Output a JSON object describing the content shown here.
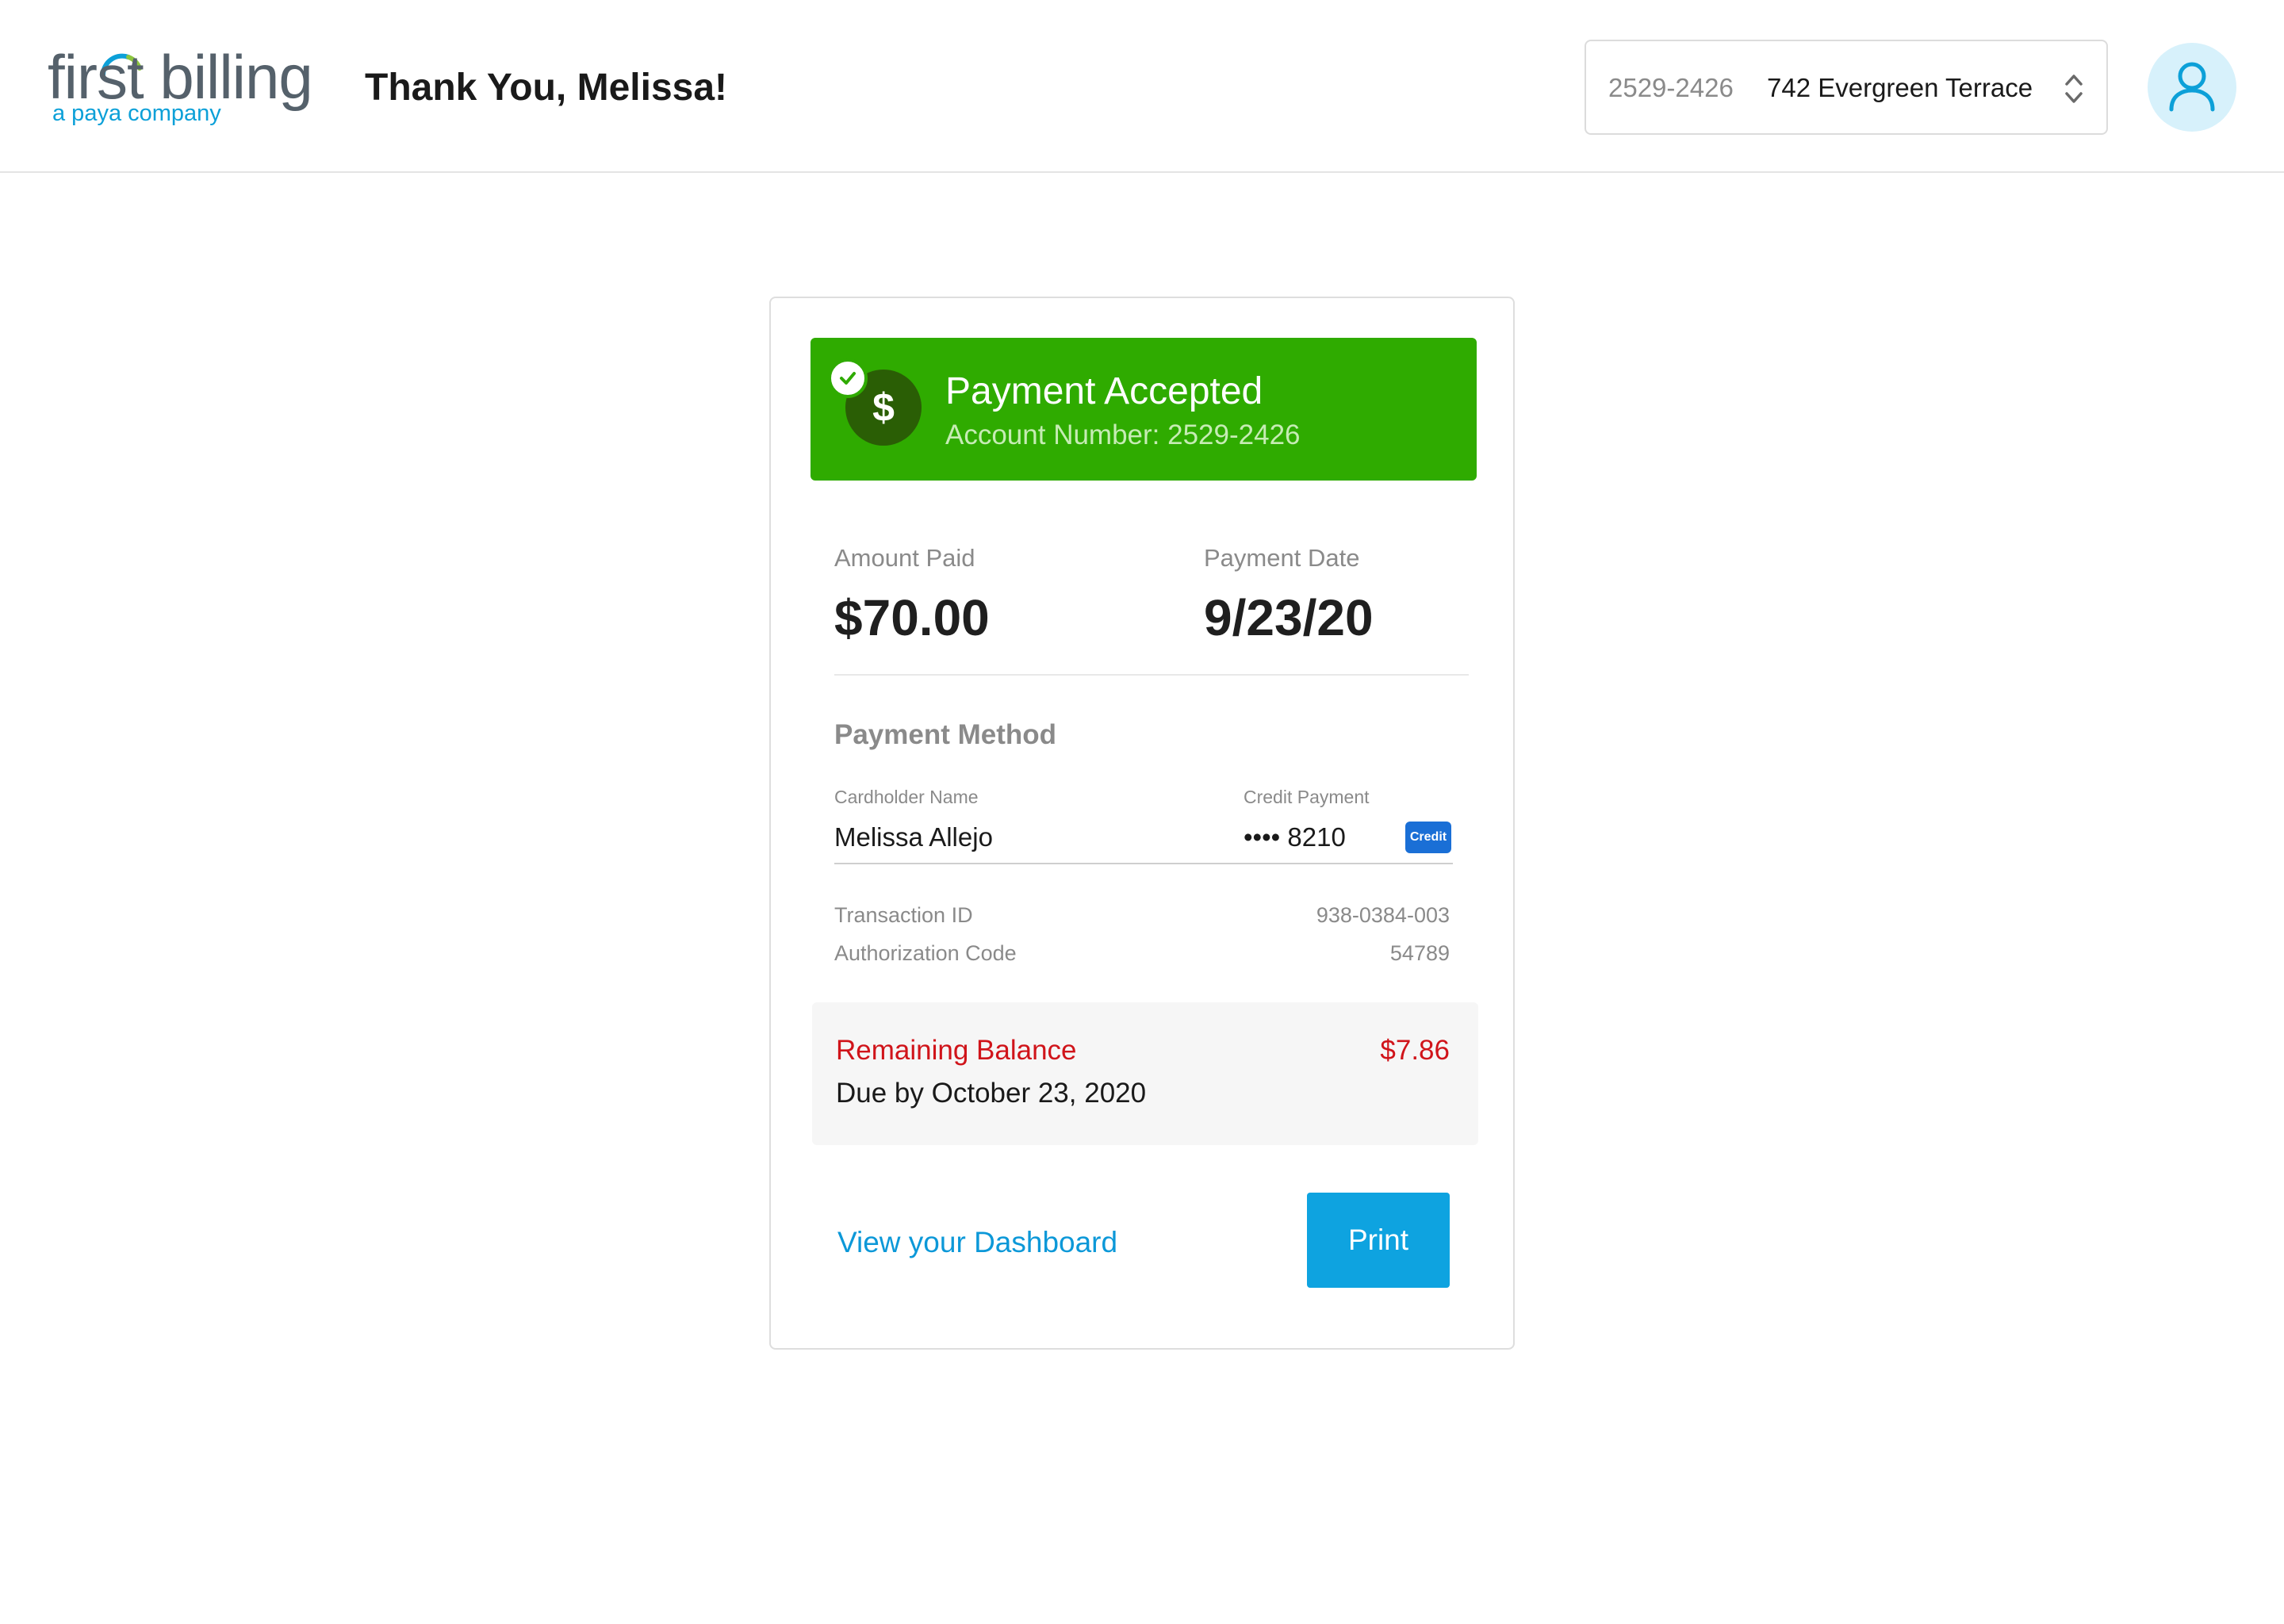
{
  "header": {
    "logo": {
      "main": "first billing",
      "sub": "a paya company"
    },
    "greeting": "Thank You, Melissa!",
    "account_select": {
      "number": "2529-2426",
      "address": "742 Evergreen Terrace"
    },
    "user_icon": "user-icon"
  },
  "confirmation": {
    "banner": {
      "title": "Payment Accepted",
      "subtitle": "Account Number: 2529-2426",
      "icons": [
        "dollar-icon",
        "check-icon"
      ]
    },
    "amount_paid": {
      "label": "Amount Paid",
      "value": "$70.00"
    },
    "payment_date": {
      "label": "Payment Date",
      "value": "9/23/20"
    },
    "payment_method": {
      "heading": "Payment Method",
      "cardholder_label": "Cardholder Name",
      "cardholder_value": "Melissa Allejo",
      "card_label": "Credit Payment",
      "card_value": "•••• 8210",
      "card_badge": "Credit"
    },
    "transaction": {
      "id_label": "Transaction ID",
      "id_value": "938-0384-003",
      "auth_label": "Authorization Code",
      "auth_value": "54789"
    },
    "balance": {
      "label": "Remaining Balance",
      "amount": "$7.86",
      "due": "Due by October 23, 2020"
    },
    "actions": {
      "dashboard_link": "View your Dashboard",
      "print_button": "Print"
    }
  },
  "colors": {
    "success_green": "#2fab00",
    "success_icon_bg": "#2a5e05",
    "accent_blue": "#0ea3e0",
    "alert_red": "#d0141a",
    "badge_blue": "#1a6fd6",
    "logo_gray": "#55616b",
    "logo_blue": "#0ca0d8"
  }
}
